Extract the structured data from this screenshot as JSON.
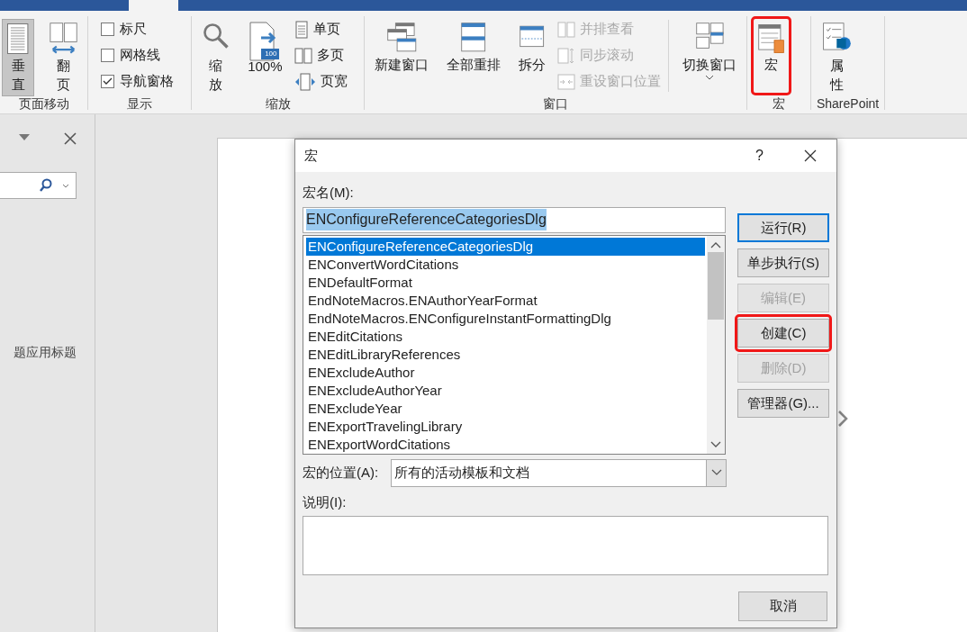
{
  "ribbon": {
    "groups": [
      {
        "label": "页面移动",
        "items": [
          {
            "kind": "large_narrow",
            "label": "垂直",
            "selected": true,
            "highlighted": false
          },
          {
            "kind": "large_narrow",
            "label": "翻页",
            "selected": false,
            "highlighted": false
          }
        ]
      },
      {
        "label": "显示",
        "items": [
          {
            "kind": "checks",
            "entries": [
              {
                "label": "标尺",
                "checked": false
              },
              {
                "label": "网格线",
                "checked": false
              },
              {
                "label": "导航窗格",
                "checked": true
              }
            ]
          }
        ]
      },
      {
        "label": "缩放",
        "items": [
          {
            "kind": "large_narrow",
            "label": "缩放",
            "selected": false,
            "highlighted": false
          },
          {
            "kind": "large",
            "label": "100%",
            "badge": "100",
            "selected": false,
            "highlighted": false
          },
          {
            "kind": "smalls",
            "entries": [
              {
                "label": "单页",
                "disabled": false
              },
              {
                "label": "多页",
                "disabled": false
              },
              {
                "label": "页宽",
                "disabled": false
              }
            ]
          }
        ]
      },
      {
        "label": "窗口",
        "items": [
          {
            "kind": "large",
            "label": "新建窗口",
            "selected": false,
            "highlighted": false
          },
          {
            "kind": "large",
            "label": "全部重排",
            "selected": false,
            "highlighted": false
          },
          {
            "kind": "large",
            "label": "拆分",
            "selected": false,
            "highlighted": false
          },
          {
            "kind": "smalls",
            "entries": [
              {
                "label": "并排查看",
                "disabled": true
              },
              {
                "label": "同步滚动",
                "disabled": true
              },
              {
                "label": "重设窗口位置",
                "disabled": true
              }
            ]
          },
          {
            "kind": "large",
            "label": "切换窗口",
            "dropdown": true,
            "selected": false,
            "highlighted": false
          }
        ]
      },
      {
        "label": "宏",
        "items": [
          {
            "kind": "large",
            "label": "宏",
            "selected": false,
            "highlighted": true
          }
        ]
      },
      {
        "label": "SharePoint",
        "items": [
          {
            "kind": "large_narrow",
            "label": "属性",
            "selected": false,
            "highlighted": false
          }
        ]
      }
    ]
  },
  "nav_pane": {
    "hint": "题应用标题"
  },
  "dialog": {
    "title": "宏",
    "help_glyph": "?",
    "name_label": "宏名(M):",
    "name_value": "ENConfigureReferenceCategoriesDlg",
    "name_text_selected": true,
    "macros": [
      {
        "name": "ENConfigureReferenceCategoriesDlg",
        "selected": true
      },
      {
        "name": "ENConvertWordCitations",
        "selected": false
      },
      {
        "name": "ENDefaultFormat",
        "selected": false
      },
      {
        "name": "EndNoteMacros.ENAuthorYearFormat",
        "selected": false
      },
      {
        "name": "EndNoteMacros.ENConfigureInstantFormattingDlg",
        "selected": false
      },
      {
        "name": "ENEditCitations",
        "selected": false
      },
      {
        "name": "ENEditLibraryReferences",
        "selected": false
      },
      {
        "name": "ENExcludeAuthor",
        "selected": false
      },
      {
        "name": "ENExcludeAuthorYear",
        "selected": false
      },
      {
        "name": "ENExcludeYear",
        "selected": false
      },
      {
        "name": "ENExportTravelingLibrary",
        "selected": false
      },
      {
        "name": "ENExportWordCitations",
        "selected": false
      }
    ],
    "buttons": [
      {
        "label": "运行(R)",
        "default": true,
        "disabled": false,
        "highlighted": false
      },
      {
        "label": "单步执行(S)",
        "default": false,
        "disabled": false,
        "highlighted": false
      },
      {
        "label": "编辑(E)",
        "default": false,
        "disabled": true,
        "highlighted": false
      },
      {
        "label": "创建(C)",
        "default": false,
        "disabled": false,
        "highlighted": true
      },
      {
        "label": "删除(D)",
        "default": false,
        "disabled": true,
        "highlighted": false
      },
      {
        "label": "管理器(G)...",
        "default": false,
        "disabled": false,
        "highlighted": false
      }
    ],
    "location_label": "宏的位置(A):",
    "location_value": "所有的活动模板和文档",
    "description_label": "说明(I):",
    "cancel_label": "取消"
  }
}
